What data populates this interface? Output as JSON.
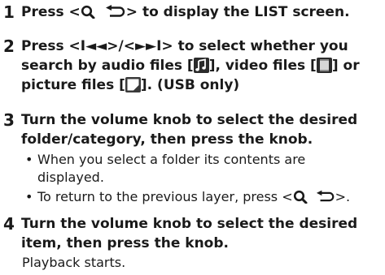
{
  "steps": [
    {
      "number": "1",
      "pre": "Press <",
      "post": "> to display the LIST screen."
    },
    {
      "number": "2",
      "line1": "Press <I◄◄>/<►►I> to select whether you",
      "line2_pre": "search by audio files [",
      "line2_mid": "], video files [",
      "line2_post": "] or",
      "line3_pre": "picture files [",
      "line3_post": "]. (USB only)"
    },
    {
      "number": "3",
      "line1": "Turn the volume knob to select the desired",
      "line2": "folder/category, then press the knob.",
      "bullets": [
        {
          "line1": "When you select a folder its contents are",
          "line2": "displayed."
        },
        {
          "pre": "To return to the previous layer, press <",
          "post": ">."
        }
      ],
      "bullet_char": "•"
    },
    {
      "number": "4",
      "line1": "Turn the volume knob to select the desired",
      "line2": "item, then press the knob.",
      "result": "Playback starts."
    }
  ],
  "icons": {
    "search": "search-icon",
    "back": "back-arrow-icon",
    "audio": "music-note-icon",
    "video": "video-file-icon",
    "picture": "picture-file-icon"
  }
}
